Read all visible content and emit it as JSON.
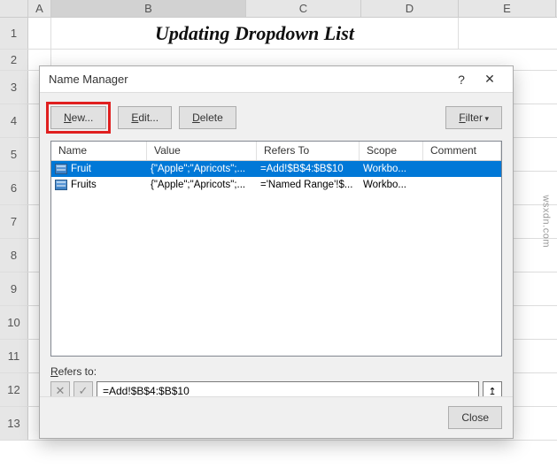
{
  "sheet": {
    "columns": [
      "A",
      "B",
      "C",
      "D",
      "E"
    ],
    "rows": [
      "1",
      "2",
      "3",
      "4",
      "5",
      "6",
      "7",
      "8",
      "9",
      "10",
      "11",
      "12",
      "13"
    ],
    "title": "Updating Dropdown List"
  },
  "dialog": {
    "title": "Name Manager",
    "toolbar": {
      "new_label": "New...",
      "edit_label": "Edit...",
      "delete_label": "Delete",
      "filter_label": "Filter"
    },
    "grid": {
      "headers": {
        "name": "Name",
        "value": "Value",
        "refers": "Refers To",
        "scope": "Scope",
        "comment": "Comment"
      },
      "rows": [
        {
          "name": "Fruit",
          "value": "{\"Apple\";\"Apricots\";...",
          "refers": "=Add!$B$4:$B$10",
          "scope": "Workbo...",
          "comment": "",
          "selected": true
        },
        {
          "name": "Fruits",
          "value": "{\"Apple\";\"Apricots\";...",
          "refers": "='Named Range'!$...",
          "scope": "Workbo...",
          "comment": "",
          "selected": false
        }
      ]
    },
    "refers": {
      "label": "Refers to:",
      "value": "=Add!$B$4:$B$10"
    },
    "close_label": "Close"
  },
  "watermark": "wsxdn.com"
}
